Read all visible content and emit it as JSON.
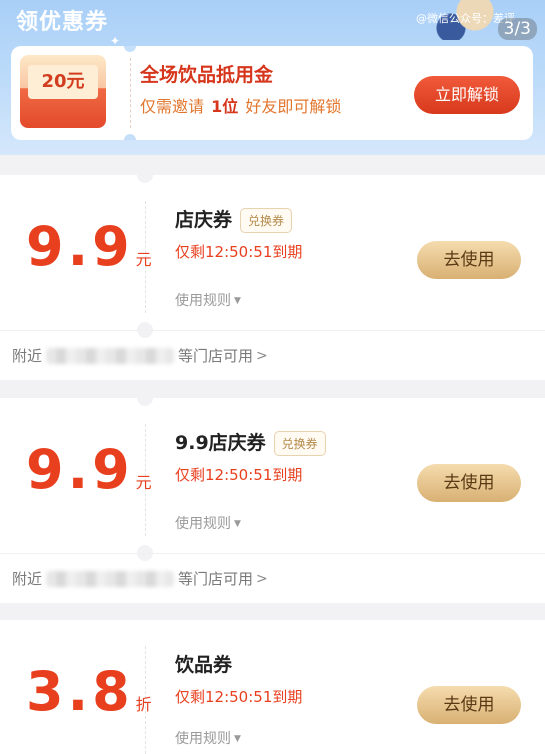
{
  "header": {
    "title": "领优惠券",
    "watermark": "@微信公众号：差评",
    "pager": "3/3"
  },
  "invite": {
    "amount": "20元",
    "title": "全场饮品抵用金",
    "sub_prefix": "仅需邀请",
    "sub_count": "1位",
    "sub_suffix": "好友即可解锁",
    "button": "立即解锁"
  },
  "coupons": [
    {
      "value": "9.9",
      "unit": "元",
      "name": "店庆券",
      "tag": "兑换券",
      "expire": "仅剩12:50:51到期",
      "rules": "使用规则",
      "button": "去使用",
      "nearby_prefix": "附近",
      "nearby_suffix": "等门店可用"
    },
    {
      "value": "9.9",
      "unit": "元",
      "name": "9.9店庆券",
      "tag": "兑换券",
      "expire": "仅剩12:50:51到期",
      "rules": "使用规则",
      "button": "去使用",
      "nearby_prefix": "附近",
      "nearby_suffix": "等门店可用"
    },
    {
      "value": "3.8",
      "unit": "折",
      "name": "饮品券",
      "tag": "",
      "expire": "仅剩12:50:51到期",
      "rules": "使用规则",
      "button": "去使用"
    }
  ]
}
